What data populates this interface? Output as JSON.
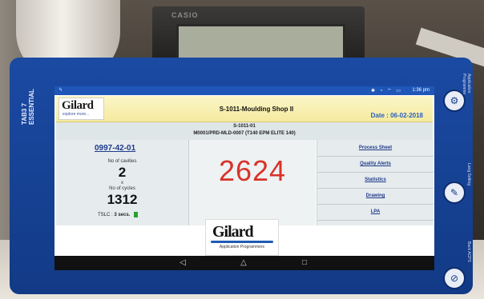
{
  "backdrop": {
    "calculator_brand": "CASIO"
  },
  "tablet": {
    "model": "TAB3 7 ESSENTIAL",
    "side_labels": [
      "Application Programme",
      "Lang Setting",
      "Back ACPS"
    ]
  },
  "statusbar": {
    "time": "1:36 pm",
    "icons": "✱ ◔ ⌔ ▭"
  },
  "header": {
    "logo": "Gilard",
    "logo_tagline": "explore more...",
    "title": "S-1011-Moulding Shop II",
    "date": "Date : 06-02-2018"
  },
  "machine": {
    "id": "S-1011-01",
    "program": "M0001/PRD-MLD-0007 (T140 EPM ELITE 140)"
  },
  "mould": {
    "code": "0997-42-01",
    "cavities_label": "No of cavities",
    "cavities": "2",
    "times_symbol": "x",
    "cycles_label": "No of cycles",
    "cycles": "1312",
    "tslc_label": "TSLC :",
    "tslc_value": "3 secs."
  },
  "counter": {
    "value": "2624",
    "color": "#d8332a"
  },
  "links": [
    "Process Sheet",
    "Quality Alerts",
    "Statistics",
    "Drawing",
    "LPA"
  ],
  "footer": {
    "logo": "Gilard",
    "tagline": "Application Programmers"
  },
  "navbar": {
    "back": "◁",
    "home": "△",
    "recent": "□"
  }
}
